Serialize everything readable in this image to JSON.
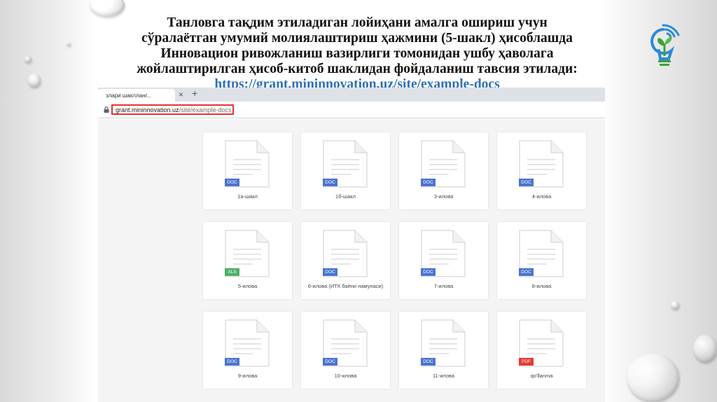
{
  "slide": {
    "title_lines": [
      "Танловга тақдим этиладиган лойиҳани амалга ошириш учун",
      "сўралаётган умумий молиялаштириш ҳажмини (5-шакл) ҳисоблашда",
      "Инновацион ривожланиш вазирлиги томонидан ушбу ҳаволага",
      "жойлаштирилган ҳисоб-китоб шаклидан фойдаланиш тавсия этилади:"
    ],
    "link": "https://grant.mininnovation.uz/site/example-docs"
  },
  "browser": {
    "tab_title": "злари шаклланг...",
    "tab_close": "×",
    "tab_new": "+",
    "url_host": "grant.mininnovation.uz",
    "url_path": "/site/example-docs"
  },
  "colors": {
    "doc_badge": "#4a74cf",
    "xls_badge": "#4caf6a",
    "pdf_badge": "#e53935",
    "url_highlight": "#e53333",
    "link": "#2f6fb7"
  },
  "files": [
    {
      "label": "1а-шакл",
      "type": "DOC"
    },
    {
      "label": "1б-шакл",
      "type": "DOC"
    },
    {
      "label": "3-илова",
      "type": "DOC"
    },
    {
      "label": "4-илова",
      "type": "DOC"
    },
    {
      "label": "5-илова",
      "type": "XLS"
    },
    {
      "label": "6-илова (ИТК баёни намунаси)",
      "type": "DOC"
    },
    {
      "label": "7-илова",
      "type": "DOC"
    },
    {
      "label": "8-илова",
      "type": "DOC"
    },
    {
      "label": "9-илова",
      "type": "DOC"
    },
    {
      "label": "10-илова",
      "type": "DOC"
    },
    {
      "label": "11-илова",
      "type": "DOC"
    },
    {
      "label": "qo'llanma",
      "type": "PDF"
    }
  ]
}
